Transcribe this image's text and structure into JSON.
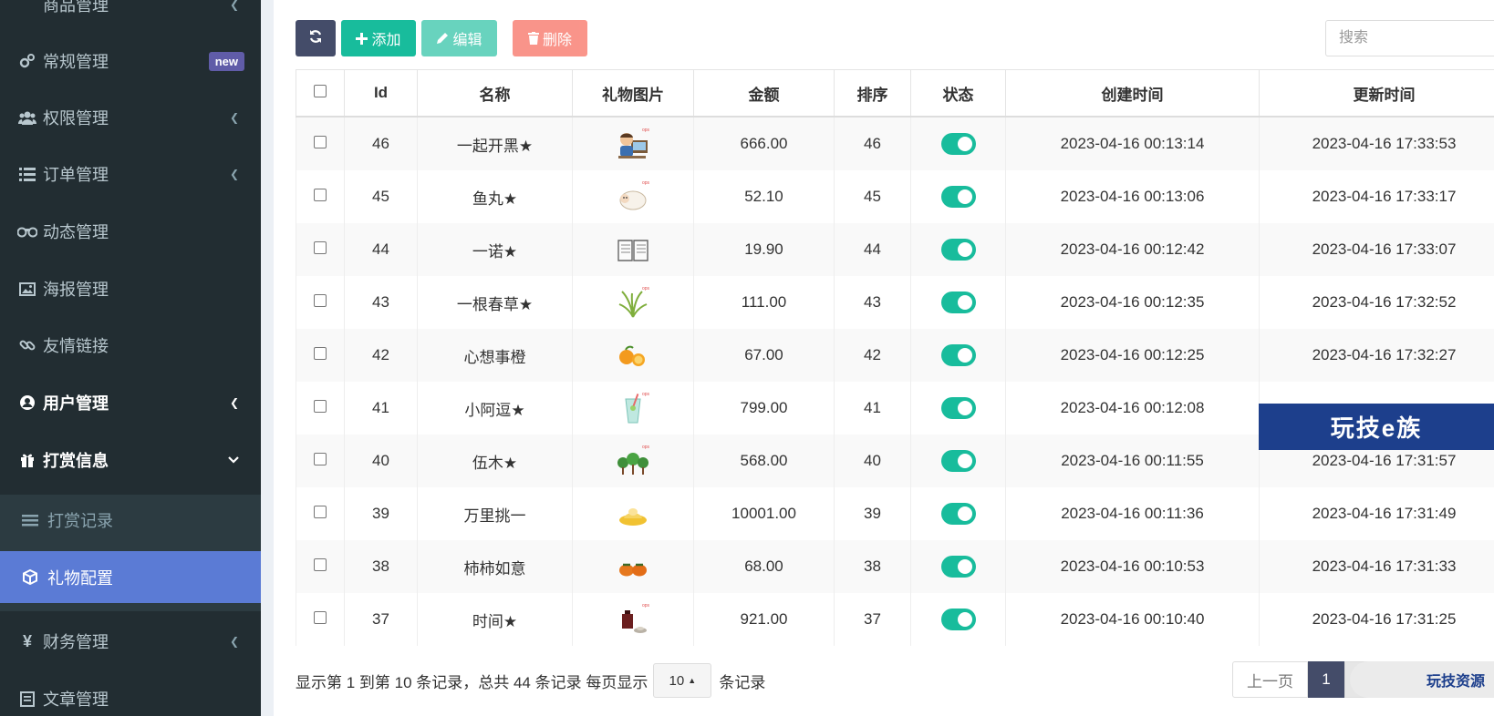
{
  "sidebar": {
    "items": [
      {
        "label": "商品管理",
        "icon": "box-icon"
      },
      {
        "label": "常规管理",
        "icon": "gears-icon",
        "badge": "new"
      },
      {
        "label": "权限管理",
        "icon": "users-icon"
      },
      {
        "label": "订单管理",
        "icon": "list-icon"
      },
      {
        "label": "动态管理",
        "icon": "binoculars-icon"
      },
      {
        "label": "海报管理",
        "icon": "image-icon"
      },
      {
        "label": "友情链接",
        "icon": "link-icon"
      },
      {
        "label": "用户管理",
        "icon": "user-circle-icon"
      },
      {
        "label": "打赏信息",
        "icon": "gift-icon"
      }
    ],
    "submenu": [
      {
        "label": "打赏记录",
        "icon": "bars-icon"
      },
      {
        "label": "礼物配置",
        "icon": "cube-icon",
        "active": true
      }
    ],
    "after": [
      {
        "label": "财务管理",
        "icon": "yen-icon"
      },
      {
        "label": "文章管理",
        "icon": "document-icon"
      }
    ]
  },
  "toolbar": {
    "add_label": "添加",
    "edit_label": "编辑",
    "delete_label": "删除"
  },
  "search": {
    "placeholder": "搜索"
  },
  "table": {
    "headers": [
      "Id",
      "名称",
      "礼物图片",
      "金额",
      "排序",
      "状态",
      "创建时间",
      "更新时间"
    ],
    "rows": [
      {
        "id": "46",
        "name": "一起开黑★",
        "image": "gamer-icon",
        "amount": "666.00",
        "sort": "46",
        "status": true,
        "created": "2023-04-16 00:13:14",
        "updated": "2023-04-16 17:33:53"
      },
      {
        "id": "45",
        "name": "鱼丸★",
        "image": "sheep-icon",
        "amount": "52.10",
        "sort": "45",
        "status": true,
        "created": "2023-04-16 00:13:06",
        "updated": "2023-04-16 17:33:17"
      },
      {
        "id": "44",
        "name": "一诺★",
        "image": "book-icon",
        "amount": "19.90",
        "sort": "44",
        "status": true,
        "created": "2023-04-16 00:12:42",
        "updated": "2023-04-16 17:33:07"
      },
      {
        "id": "43",
        "name": "一根春草★",
        "image": "grass-icon",
        "amount": "111.00",
        "sort": "43",
        "status": true,
        "created": "2023-04-16 00:12:35",
        "updated": "2023-04-16 17:32:52"
      },
      {
        "id": "42",
        "name": "心想事橙",
        "image": "orange-icon",
        "amount": "67.00",
        "sort": "42",
        "status": true,
        "created": "2023-04-16 00:12:25",
        "updated": "2023-04-16 17:32:27"
      },
      {
        "id": "41",
        "name": "小阿逗★",
        "image": "drink-icon",
        "amount": "799.00",
        "sort": "41",
        "status": true,
        "created": "2023-04-16 00:12:08",
        "updated": ""
      },
      {
        "id": "40",
        "name": "伍木★",
        "image": "trees-icon",
        "amount": "568.00",
        "sort": "40",
        "status": true,
        "created": "2023-04-16 00:11:55",
        "updated": "2023-04-16 17:31:57"
      },
      {
        "id": "39",
        "name": "万里挑一",
        "image": "ingot-icon",
        "amount": "10001.00",
        "sort": "39",
        "status": true,
        "created": "2023-04-16 00:11:36",
        "updated": "2023-04-16 17:31:49"
      },
      {
        "id": "38",
        "name": "柿柿如意",
        "image": "persimmon-icon",
        "amount": "68.00",
        "sort": "38",
        "status": true,
        "created": "2023-04-16 00:10:53",
        "updated": "2023-04-16 17:31:33"
      },
      {
        "id": "37",
        "name": "时间★",
        "image": "teapot-icon",
        "amount": "921.00",
        "sort": "37",
        "status": true,
        "created": "2023-04-16 00:10:40",
        "updated": "2023-04-16 17:31:25"
      }
    ]
  },
  "footer": {
    "summary": "显示第 1 到第 10 条记录，总共 44 条记录 每页显示",
    "page_size": "10",
    "suffix": "条记录"
  },
  "pager": {
    "prev": "上一页",
    "current": "1"
  },
  "watermark": {
    "banner": "玩技e族",
    "corner": "玩技资源"
  },
  "colors": {
    "sidebar_bg": "#222d32",
    "active_item": "#5b7bd5",
    "accent": "#18bc9c",
    "danger": "#f75c4c",
    "dark_btn": "#444c69"
  }
}
